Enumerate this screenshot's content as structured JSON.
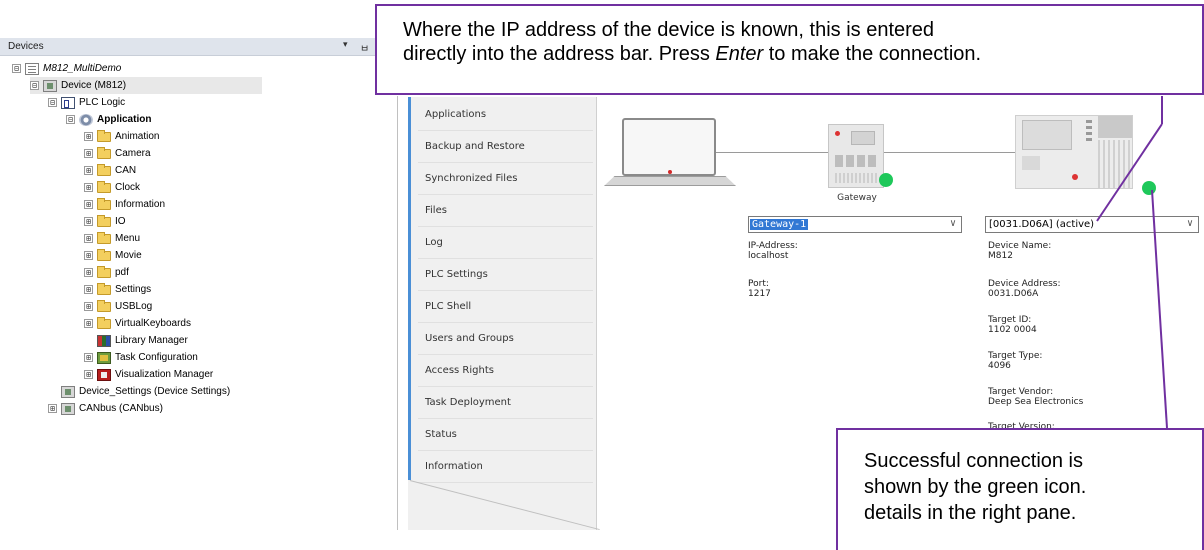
{
  "devices_panel": {
    "title": "Devices",
    "dropdown_glyph": "▾",
    "pin_glyph": "ㅂ",
    "tree": [
      {
        "label": "M812_MultiDemo",
        "icon": "project-icon",
        "expander": "⊟"
      },
      {
        "label": "Device (M812)",
        "icon": "device-icon",
        "expander": "⊟"
      },
      {
        "label": "PLC Logic",
        "icon": "plc-logic-icon",
        "expander": "⊟"
      },
      {
        "label": "Application",
        "icon": "gear-icon",
        "expander": "⊟"
      },
      {
        "label": "Animation",
        "icon": "folder-icon",
        "expander": "⊞"
      },
      {
        "label": "Camera",
        "icon": "folder-icon",
        "expander": "⊞"
      },
      {
        "label": "CAN",
        "icon": "folder-icon",
        "expander": "⊞"
      },
      {
        "label": "Clock",
        "icon": "folder-icon",
        "expander": "⊞"
      },
      {
        "label": "Information",
        "icon": "folder-icon",
        "expander": "⊞"
      },
      {
        "label": "IO",
        "icon": "folder-icon",
        "expander": "⊞"
      },
      {
        "label": "Menu",
        "icon": "folder-icon",
        "expander": "⊞"
      },
      {
        "label": "Movie",
        "icon": "folder-icon",
        "expander": "⊞"
      },
      {
        "label": "pdf",
        "icon": "folder-icon",
        "expander": "⊞"
      },
      {
        "label": "Settings",
        "icon": "folder-icon",
        "expander": "⊞"
      },
      {
        "label": "USBLog",
        "icon": "folder-icon",
        "expander": "⊞"
      },
      {
        "label": "VirtualKeyboards",
        "icon": "folder-icon",
        "expander": "⊞"
      },
      {
        "label": "Library Manager",
        "icon": "library-icon",
        "expander": ""
      },
      {
        "label": "Task Configuration",
        "icon": "task-icon",
        "expander": "⊞"
      },
      {
        "label": "Visualization Manager",
        "icon": "visualization-icon",
        "expander": "⊞"
      },
      {
        "label": "Device_Settings (Device Settings)",
        "icon": "device-icon",
        "expander": ""
      },
      {
        "label": "CANbus (CANbus)",
        "icon": "device-icon",
        "expander": "⊞"
      }
    ]
  },
  "side_menu": [
    "Applications",
    "Backup and Restore",
    "Synchronized Files",
    "Files",
    "Log",
    "PLC Settings",
    "PLC Shell",
    "Users and Groups",
    "Access Rights",
    "Task Deployment",
    "Status",
    "Information"
  ],
  "topology": {
    "gateway_label": "Gateway",
    "status_color": "#1ec85a"
  },
  "gateway_select": {
    "value": "Gateway-1",
    "arrow": "∨"
  },
  "device_select": {
    "value": "[0031.D06A] (active)",
    "arrow": "∨"
  },
  "gateway_info": {
    "ip_label": "IP-Address:",
    "ip_value": "localhost",
    "port_label": "Port:",
    "port_value": "1217"
  },
  "device_info": {
    "name_label": "Device Name:",
    "name_value": "M812",
    "address_label": "Device Address:",
    "address_value": "0031.D06A",
    "target_id_label": "Target ID:",
    "target_id_value": "1102  0004",
    "target_type_label": "Target Type:",
    "target_type_value": "4096",
    "vendor_label": "Target Vendor:",
    "vendor_value": "Deep Sea Electronics",
    "version_label": "Target Version:"
  },
  "callouts": {
    "top_line1": "Where the IP address of the device is known, this is entered",
    "top_line2_pre": "directly into the address bar. Press ",
    "top_line2_em": "Enter",
    "top_line2_post": " to make the connection.",
    "bottom_line1": "Successful connection is",
    "bottom_line2": "shown by the green icon.",
    "bottom_line3": "details in the right pane.",
    "border_color": "#7030a0"
  }
}
